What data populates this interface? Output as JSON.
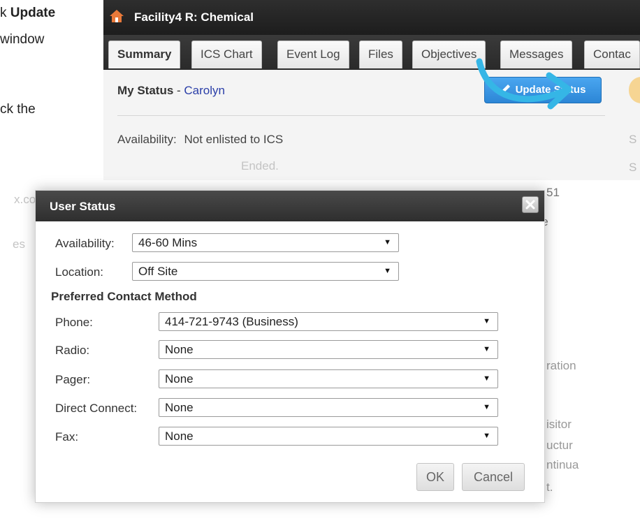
{
  "doc": {
    "line1_prefix": "k ",
    "line1_bold": "Update",
    "line2": "window",
    "line3": "ck the"
  },
  "facility": {
    "title": "Facility4 R: Chemical",
    "tabs": [
      "Summary",
      "ICS Chart",
      "Event Log",
      "Files",
      "Objectives",
      "Messages",
      "Contac"
    ],
    "active_tab": "Summary",
    "my_status_label": "My Status",
    "my_status_sep": " - ",
    "my_status_user": "Carolyn",
    "availability_label": "Availability:",
    "availability_value": "Not enlisted to ICS",
    "update_status_label": "Update Status",
    "right_fragment_1": "S",
    "right_fragment_2": "S"
  },
  "ghost_text": {
    "ended": "Ended.",
    "timestamp_tail": "51",
    "close": "close",
    "left_domain": "x.co",
    "left_es": "es",
    "right_1": "ration",
    "right_2": "isitor",
    "right_3": "uctur",
    "right_4": "ntinua",
    "right_5": "t."
  },
  "dialog": {
    "title": "User Status",
    "availability_label": "Availability:",
    "availability_value": "46-60 Mins",
    "location_label": "Location:",
    "location_value": "Off Site",
    "preferred_contact_label": "Preferred Contact Method",
    "phone_label": "Phone:",
    "phone_value": "414-721-9743 (Business)",
    "radio_label": "Radio:",
    "radio_value": "None",
    "pager_label": "Pager:",
    "pager_value": "None",
    "direct_connect_label": "Direct Connect:",
    "direct_connect_value": "None",
    "fax_label": "Fax:",
    "fax_value": "None",
    "ok_label": "OK",
    "cancel_label": "Cancel"
  },
  "colors": {
    "update_button": "#2c86d6",
    "swoosh": "#35b6e6",
    "user_link": "#2a3ea8"
  }
}
